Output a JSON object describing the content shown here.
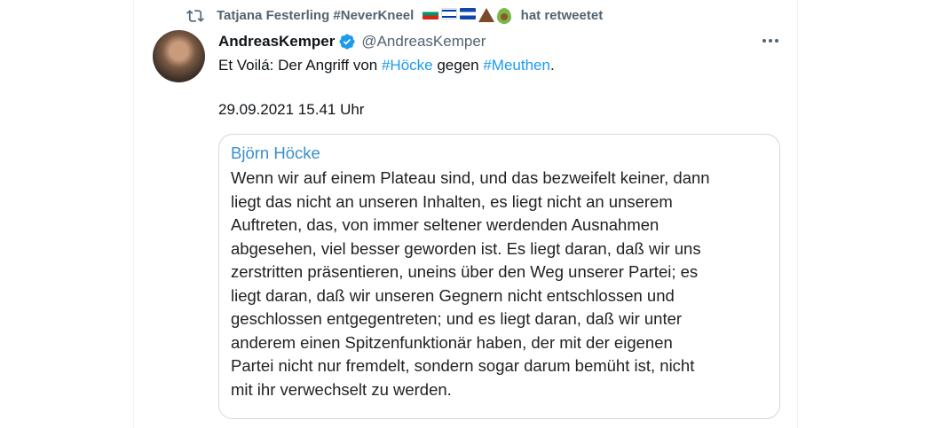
{
  "retweet": {
    "user": "Tatjana Festerling #NeverKneel",
    "suffix": "hat retweetet",
    "emojis": [
      "flag-bulgaria",
      "flag-israel",
      "flag-el-salvador",
      "volcano",
      "avocado"
    ]
  },
  "tweet": {
    "display_name": "AndreasKemper",
    "handle": "@AndreasKemper",
    "text_prefix": "Et Voilá: Der Angriff von ",
    "hashtag1": "#Höcke",
    "text_middle": " gegen ",
    "hashtag2": "#Meuthen",
    "text_suffix": ".",
    "date": "29.09.2021 15.41 Uhr"
  },
  "quote_card": {
    "author": "Björn Höcke",
    "lines": [
      "Wenn wir auf einem Plateau sind, und das bezweifelt keiner, dann",
      "liegt das nicht an unseren Inhalten, es liegt nicht an unserem",
      "Auftreten, das, von immer seltener werdenden Ausnahmen",
      "abgesehen, viel besser geworden ist. Es liegt daran, daß wir uns",
      "zerstritten präsentieren, uneins über den Weg unserer Partei; es",
      "liegt daran, daß wir unseren Gegnern nicht entschlossen und",
      "geschlossen entgegentreten; und es liegt daran, daß wir unter",
      "anderem einen Spitzenfunktionär haben, der mit der eigenen",
      "Partei nicht nur fremdelt, sondern sogar darum bemüht ist, nicht",
      "mit ihr verwechselt zu werden."
    ]
  },
  "colors": {
    "link": "#1d9bf0",
    "secondary": "#536471",
    "verified": "#1d9bf0",
    "quote_author": "#3a8fcf"
  }
}
